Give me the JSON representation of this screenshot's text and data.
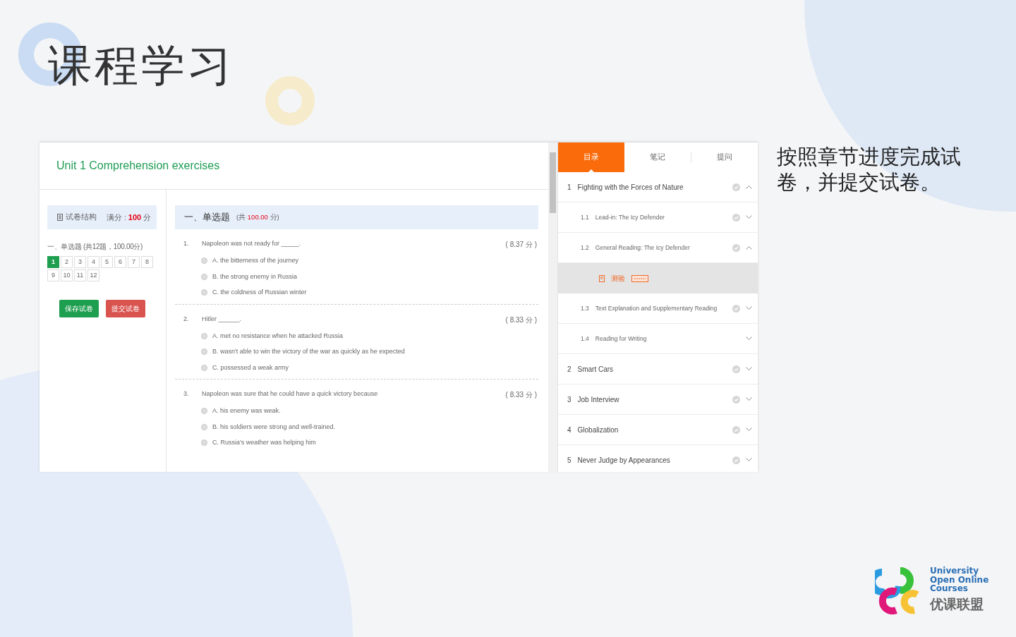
{
  "slide": {
    "title": "课程学习",
    "caption": "按照章节进度完成试卷，并提交试卷。"
  },
  "logo": {
    "lines": [
      "University",
      "Open Online",
      "Courses"
    ],
    "name_cn": "优课联盟"
  },
  "exam": {
    "title": "Unit 1 Comprehension exercises",
    "structure": {
      "label": "试卷结构",
      "full_label": "满分 :",
      "full_score": "100",
      "unit": "分"
    },
    "summary": "一、单选题 (共12题，100.00分)",
    "numbers": [
      {
        "label": "1",
        "selected": true
      },
      {
        "label": "2",
        "selected": false
      },
      {
        "label": "3",
        "selected": false
      },
      {
        "label": "4",
        "selected": false
      },
      {
        "label": "5",
        "selected": false
      },
      {
        "label": "6",
        "selected": false
      },
      {
        "label": "7",
        "selected": false
      },
      {
        "label": "8",
        "selected": false
      },
      {
        "label": "9",
        "selected": false
      },
      {
        "label": "10",
        "selected": false
      },
      {
        "label": "11",
        "selected": false
      },
      {
        "label": "12",
        "selected": false
      }
    ],
    "buttons": [
      {
        "label": "保存试卷",
        "kind": "save"
      },
      {
        "label": "提交试卷",
        "kind": "submit"
      }
    ],
    "section": {
      "title": "一、单选题",
      "total_prefix": "(共",
      "total": "100.00",
      "total_suffix": "分)"
    },
    "questions": [
      {
        "number": "1.",
        "text": "Napoleon was not ready for _____.",
        "score": "( 8.37 分 )",
        "options": [
          {
            "text": "A. the bitterness of the journey",
            "checked": false
          },
          {
            "text": "B. the strong enemy in Russia",
            "checked": false
          },
          {
            "text": "C. the coldness of Russian winter",
            "checked": false
          }
        ]
      },
      {
        "number": "2.",
        "text": "Hitler ______.",
        "score": "( 8.33 分 )",
        "options": [
          {
            "text": "A. met no resistance when he attacked Russia",
            "checked": false
          },
          {
            "text": "B. wasn't able to win the victory of the war as quickly as he expected",
            "checked": false
          },
          {
            "text": "C. possessed a weak army",
            "checked": false
          }
        ]
      },
      {
        "number": "3.",
        "text": "Napoleon was sure that he could have a quick victory because",
        "score": "( 8.33 分 )",
        "options": [
          {
            "text": "A. his enemy was weak.",
            "checked": false
          },
          {
            "text": "B. his soldiers were strong and well-trained.",
            "checked": false
          },
          {
            "text": "C. Russia's weather was helping him",
            "checked": false
          }
        ]
      }
    ]
  },
  "outline": {
    "tabs": [
      {
        "label": "目录",
        "selected": true
      },
      {
        "label": "笔记",
        "selected": false
      },
      {
        "label": "提问",
        "selected": false
      }
    ],
    "items": [
      {
        "kind": "chapter",
        "number": "1",
        "title": "Fighting with the Forces of Nature",
        "completed": true,
        "expanded": true,
        "children": [
          {
            "kind": "section",
            "number": "1.1",
            "title": "Lead-in: The Icy Defender",
            "completed": true,
            "expanded": false
          },
          {
            "kind": "section",
            "number": "1.2",
            "title": "General Reading: The Icy Defender",
            "completed": true,
            "expanded": true,
            "children": [
              {
                "kind": "quiz",
                "title": "测验",
                "selected": true
              }
            ]
          },
          {
            "kind": "section",
            "number": "1.3",
            "title": "Text Explanation and Supplementary Reading",
            "completed": true,
            "expanded": false
          },
          {
            "kind": "section",
            "number": "1.4",
            "title": "Reading for Writing",
            "completed": false,
            "expanded": false
          }
        ]
      },
      {
        "kind": "chapter",
        "number": "2",
        "title": "Smart Cars",
        "completed": true,
        "expanded": false
      },
      {
        "kind": "chapter",
        "number": "3",
        "title": "Job Interview",
        "completed": true,
        "expanded": false
      },
      {
        "kind": "chapter",
        "number": "4",
        "title": "Globalization",
        "completed": true,
        "expanded": false
      },
      {
        "kind": "chapter",
        "number": "5",
        "title": "Never Judge by Appearances",
        "completed": true,
        "expanded": false
      }
    ]
  }
}
